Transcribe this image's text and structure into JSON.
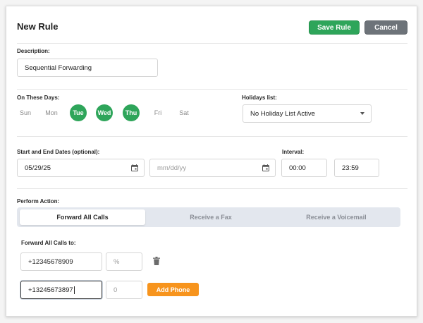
{
  "header": {
    "title": "New Rule",
    "save_label": "Save Rule",
    "cancel_label": "Cancel"
  },
  "description": {
    "label": "Description:",
    "value": "Sequential Forwarding"
  },
  "days": {
    "label": "On These Days:",
    "items": [
      {
        "label": "Sun",
        "selected": false
      },
      {
        "label": "Mon",
        "selected": false
      },
      {
        "label": "Tue",
        "selected": true
      },
      {
        "label": "Wed",
        "selected": true
      },
      {
        "label": "Thu",
        "selected": true
      },
      {
        "label": "Fri",
        "selected": false
      },
      {
        "label": "Sat",
        "selected": false
      }
    ]
  },
  "holidays": {
    "label": "Holidays list:",
    "selected": "No Holiday List Active"
  },
  "dates": {
    "label": "Start and End Dates (optional):",
    "start": "05/29/25",
    "end_placeholder": "mm/dd/yy"
  },
  "interval": {
    "label": "Interval:",
    "start": "00:00",
    "end": "23:59"
  },
  "action": {
    "label": "Perform Action:",
    "tabs": [
      "Forward All Calls",
      "Receive a Fax",
      "Receive a Voicemail"
    ],
    "active_tab": 0
  },
  "forward": {
    "label": "Forward All Calls to:",
    "rows": [
      {
        "phone": "+12345678909",
        "percent_placeholder": "%"
      },
      {
        "phone": "+13245673897",
        "percent_placeholder": "0"
      }
    ],
    "add_label": "Add Phone"
  },
  "colors": {
    "accent": "#2ea55a",
    "cancel": "#6d7379",
    "add": "#f7941d"
  }
}
